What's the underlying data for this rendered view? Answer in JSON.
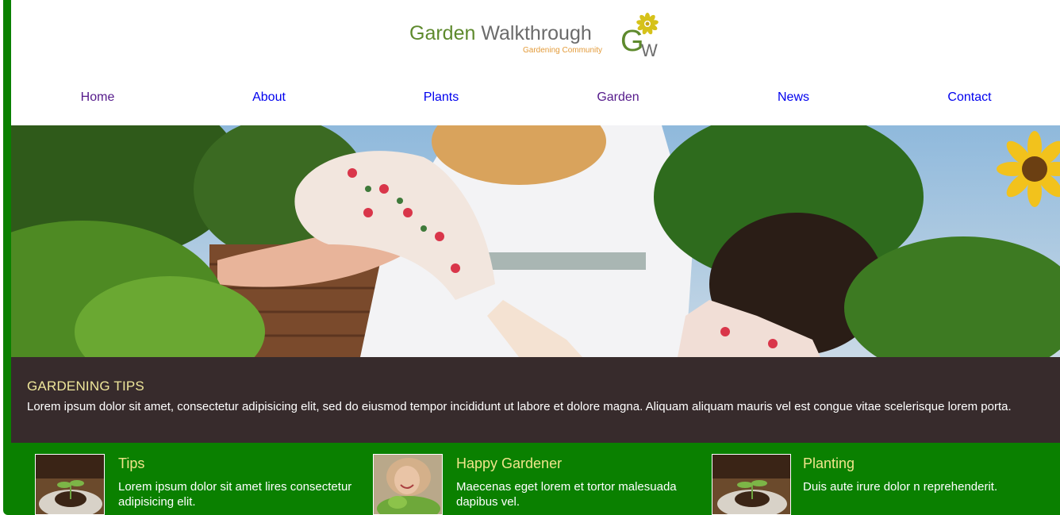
{
  "brand": {
    "title_part1": "Garden",
    "title_part2": "Walkthrough",
    "tagline": "Gardening Community",
    "monogram_g": "G",
    "monogram_w": "W",
    "colors": {
      "green": "#5e8a2d",
      "gray": "#6b6b6b",
      "orange": "#e39b3a",
      "flower": "#d6c21a"
    }
  },
  "nav": {
    "items": [
      {
        "label": "Home",
        "color": "#551a8b"
      },
      {
        "label": "About",
        "color": "#0000ee"
      },
      {
        "label": "Plants",
        "color": "#0000ee"
      },
      {
        "label": "Garden",
        "color": "#551a8b"
      },
      {
        "label": "News",
        "color": "#0000ee"
      },
      {
        "label": "Contact",
        "color": "#0000ee"
      }
    ]
  },
  "hero": {
    "image": "woman-gardening-photo"
  },
  "tips": {
    "heading": "GARDENING TIPS",
    "body": "Lorem ipsum dolor sit amet, consectetur adipisicing elit, sed do eiusmod tempor incididunt ut labore et dolore magna. Aliquam aliquam mauris vel est congue vitae scelerisque lorem porta."
  },
  "features": [
    {
      "title": "Tips",
      "text": "Lorem ipsum dolor sit amet lires consectetur adipisicing elit.",
      "thumb": "seedling-photo"
    },
    {
      "title": "Happy Gardener",
      "text": "Maecenas eget lorem et tortor malesuada dapibus vel.",
      "thumb": "smiling-gardener-photo"
    },
    {
      "title": "Planting",
      "text": "Duis aute irure dolor n reprehenderit.",
      "thumb": "seedling-photo"
    }
  ],
  "colors": {
    "frame": "#0a8000",
    "band": "#372b2c",
    "heading": "#efe79b"
  }
}
